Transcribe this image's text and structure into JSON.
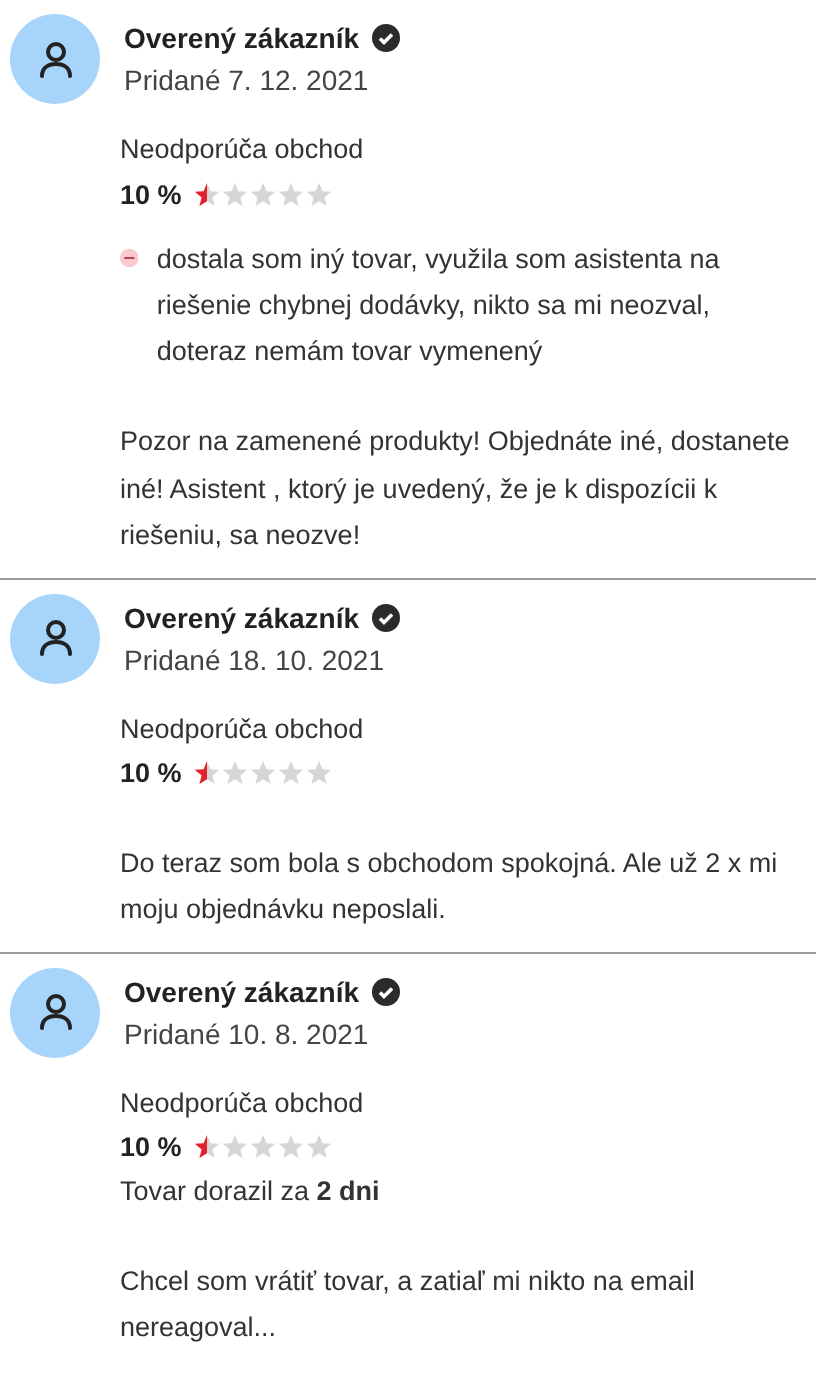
{
  "reviews": [
    {
      "author": "Overený zákazník",
      "verified": true,
      "date": "Pridané 7. 12. 2021",
      "verdict": "Neodporúča obchod",
      "percent": "10 %",
      "stars": 0.5,
      "cons": [
        "dostala som iný tovar, využila som asistenta na riešenie chybnej dodávky, nikto sa mi neozval, doteraz nemám tovar vymenený"
      ],
      "text": "Pozor na zamenené produkty! Objednáte iné, dostanete iné! Asistent , ktorý je uvedený, že je k dispozícii k riešeniu, sa neozve!"
    },
    {
      "author": "Overený zákazník",
      "verified": true,
      "date": "Pridané 18. 10. 2021",
      "verdict": "Neodporúča obchod",
      "percent": "10 %",
      "stars": 0.5,
      "text": "Do teraz som bola s obchodom spokojná. Ale už 2 x mi moju objednávku neposlali."
    },
    {
      "author": "Overený zákazník",
      "verified": true,
      "date": "Pridané 10. 8. 2021",
      "verdict": "Neodporúča obchod",
      "percent": "10 %",
      "stars": 0.5,
      "delivery": "Tovar dorazil za **2 dni**",
      "text": "Chcel som vrátiť tovar, a zatiaľ mi nikto na email nereagoval..."
    }
  ]
}
